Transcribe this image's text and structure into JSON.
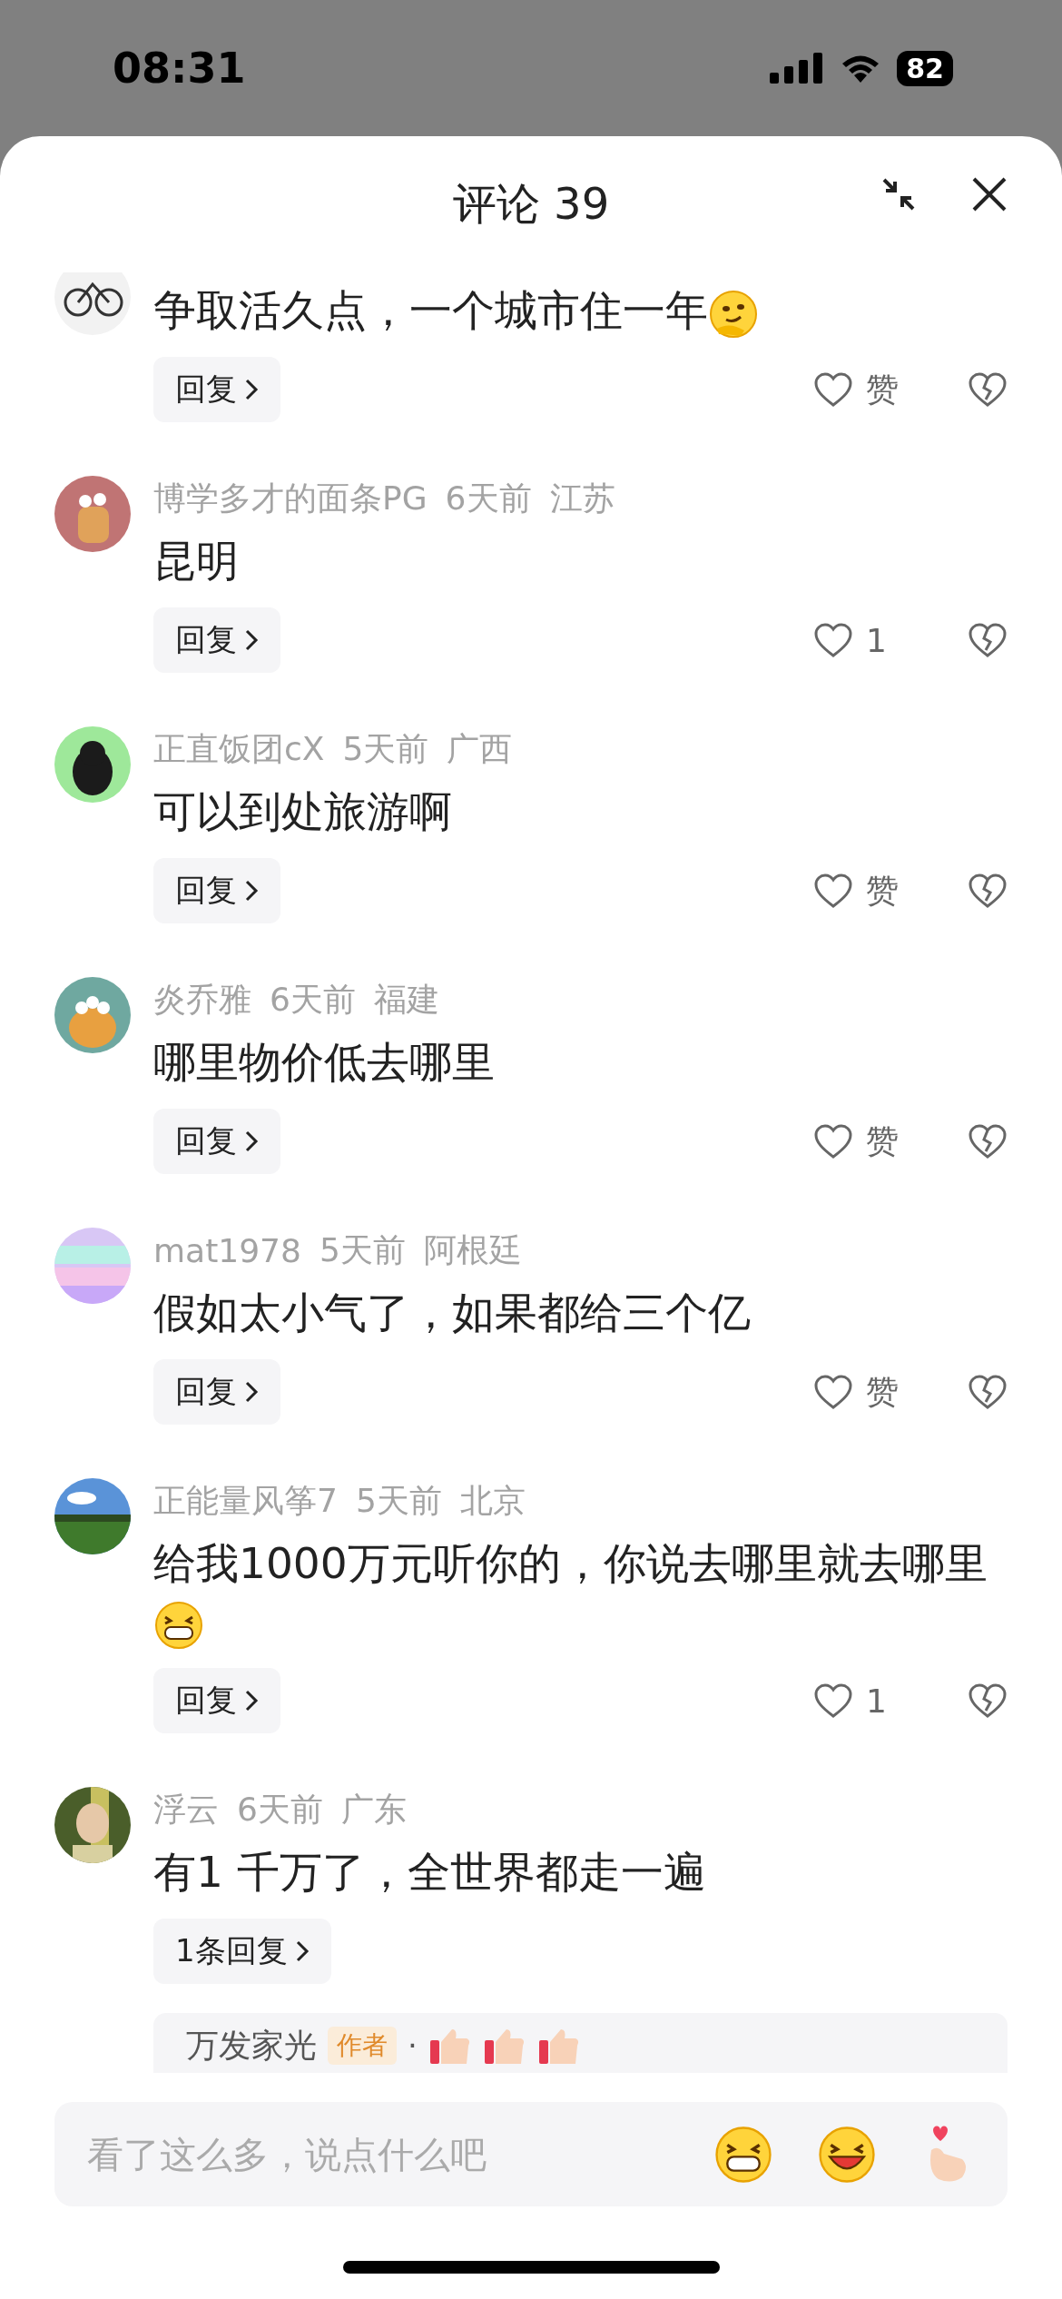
{
  "status_bar": {
    "time": "08:31",
    "battery": "82"
  },
  "header": {
    "title": "评论 39"
  },
  "comments": [
    {
      "kind": "cut",
      "text": "争取活久点，一个城市住一年",
      "emoji": {
        "kind": "smirk"
      },
      "reply_label": "回复",
      "likes": "赞"
    },
    {
      "kind": "full",
      "name": "博学多才的面条PG",
      "time": "6天前",
      "location": "江苏",
      "text": "昆明",
      "reply_label": "回复",
      "likes": "1"
    },
    {
      "kind": "full",
      "name": "正直饭团cX",
      "time": "5天前",
      "location": "广西",
      "text": "可以到处旅游啊",
      "reply_label": "回复",
      "likes": "赞"
    },
    {
      "kind": "full",
      "name": "炎乔雅",
      "time": "6天前",
      "location": "福建",
      "text": "哪里物价低去哪里",
      "reply_label": "回复",
      "likes": "赞"
    },
    {
      "kind": "full",
      "name": "mat1978",
      "time": "5天前",
      "location": "阿根廷",
      "text": "假如太小气了，如果都给三个亿",
      "reply_label": "回复",
      "likes": "赞"
    },
    {
      "kind": "full",
      "name": "正能量风筝7",
      "time": "5天前",
      "location": "北京",
      "text": "给我1000万元听你的，你说去哪里就去哪里",
      "emoji": {
        "kind": "grin"
      },
      "reply_label": "回复",
      "likes": "1"
    },
    {
      "kind": "full",
      "name": "浮云",
      "time": "6天前",
      "location": "广东",
      "text": "有1 千万了，全世界都走一遍",
      "reply_label": "1条回复",
      "reply_preview": {
        "name": "万发家光",
        "badge": "作者",
        "separator": "·"
      }
    }
  ],
  "input": {
    "placeholder": "看了这么多，说点什么吧"
  }
}
